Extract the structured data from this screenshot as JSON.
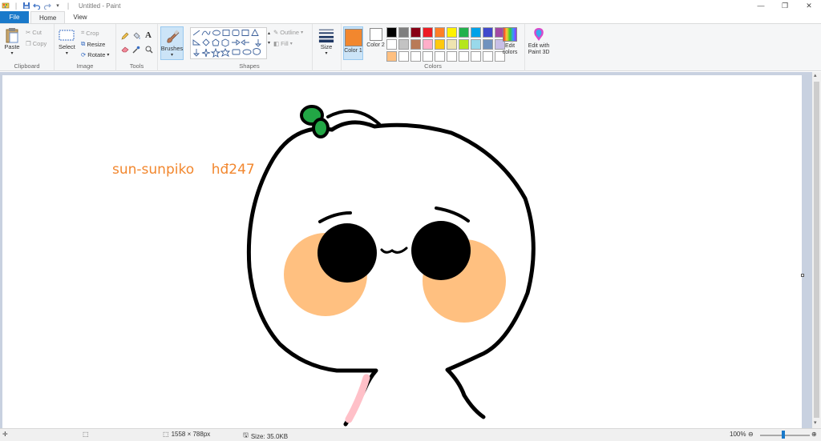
{
  "window": {
    "title": "Untitled - Paint",
    "controls": [
      "—",
      "❐",
      "✕"
    ]
  },
  "tabs": [
    {
      "label": "File"
    },
    {
      "label": "Home"
    },
    {
      "label": "View"
    }
  ],
  "ribbon": {
    "clipboard": {
      "paste": "Paste",
      "cut": "Cut",
      "copy": "Copy",
      "group": "Clipboard"
    },
    "image": {
      "select": "Select",
      "crop": "Crop",
      "resize": "Resize",
      "rotate": "Rotate",
      "group": "Image"
    },
    "tools": {
      "group": "Tools"
    },
    "brushes": {
      "label": "Brushes"
    },
    "shapes": {
      "outline": "Outline",
      "fill": "Fill",
      "group": "Shapes"
    },
    "size": {
      "label": "Size"
    },
    "colors": {
      "color1": "Color 1",
      "color2": "Color 2",
      "edit_colors": "Edit colors",
      "group": "Colors",
      "color1_value": "#f2872e",
      "color2_value": "#ffffff",
      "palette_row1": [
        "#000000",
        "#7f7f7f",
        "#880015",
        "#ed1c24",
        "#ff7f27",
        "#fff200",
        "#22b14c",
        "#00a2e8",
        "#3f48cc",
        "#a349a4"
      ],
      "palette_row2": [
        "#ffffff",
        "#c3c3c3",
        "#b97a57",
        "#ffaec9",
        "#ffc90e",
        "#efe4b0",
        "#b5e61d",
        "#99d9ea",
        "#7092be",
        "#c8bfe7"
      ],
      "palette_row3": [
        "#ffc080",
        "#ffffff",
        "#ffffff",
        "#ffffff",
        "#ffffff",
        "#ffffff",
        "#ffffff",
        "#ffffff",
        "#ffffff",
        "#ffffff"
      ]
    },
    "paint3d": {
      "label": "Edit with Paint 3D"
    }
  },
  "canvas": {
    "text": "sun-sunpiko    hđ247"
  },
  "status": {
    "dimensions": "1558 × 788px",
    "size": "Size: 35.0KB",
    "zoom": "100%"
  }
}
